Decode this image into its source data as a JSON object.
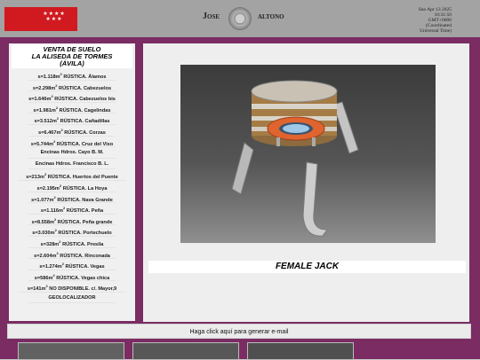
{
  "header": {
    "name_first": "Jose",
    "name_last": "altono",
    "datetime_lines": [
      "Sun Apr 13 2025",
      "10:31:50",
      "GMT+0000",
      "(Coordinated",
      "Universal Time)"
    ]
  },
  "sidebar": {
    "title_lines": [
      "VENTA DE SUELO",
      "LA ALISEDA DE TORMES",
      "(ÁVILA)"
    ],
    "items": [
      {
        "area": "s=1.118m",
        "desc": " RÚSTICA. Álamos",
        "sup": "2"
      },
      {
        "area": "s=2.298m",
        "desc": " RÚSTICA. Cabezuelos",
        "sup": "2"
      },
      {
        "area": "s=1.646m",
        "desc": " RÚSTICA. Cabezuelos bis",
        "sup": "2"
      },
      {
        "area": "s=1.981m",
        "desc": " RÚSTICA. Cagelindas",
        "sup": "2"
      },
      {
        "area": "s=3.512m",
        "desc": " RÚSTICA. Cañadillas",
        "sup": "2"
      },
      {
        "area": "s=6.467m",
        "desc": " RÚSTICA. Corzas",
        "sup": "2"
      },
      {
        "area": "s=5.744m",
        "desc": " RÚSTICA. Cruz del Viso",
        "sup": "2"
      },
      {
        "area": "",
        "desc": "Encinas Hdros. Cayo B. M.",
        "sup": ""
      },
      {
        "area": "",
        "desc": "Encinas Hdros. Francisco B. L.",
        "sup": ""
      },
      {
        "area": "s=213m",
        "desc": " RÚSTICA. Huertos del Puente",
        "sup": "2"
      },
      {
        "area": "s=2.195m",
        "desc": " RÚSTICA. La Hoya",
        "sup": "2"
      },
      {
        "area": "s=1.077m",
        "desc": " RÚSTICA. Nava Grande",
        "sup": "2"
      },
      {
        "area": "s=1.116m",
        "desc": " RÚSTICA. Peña",
        "sup": "2"
      },
      {
        "area": "s=8.558m",
        "desc": " RÚSTICA. Peña grande",
        "sup": "2"
      },
      {
        "area": "s=3.030m",
        "desc": " RÚSTICA. Portechuelo",
        "sup": "2"
      },
      {
        "area": "s=328m",
        "desc": " RÚSTICA. Presila",
        "sup": "2"
      },
      {
        "area": "s=2.604m",
        "desc": " RÚSTICA. Rinconada",
        "sup": "2"
      },
      {
        "area": "s=1.274m",
        "desc": " RÚSTICA. Vegas",
        "sup": "2"
      },
      {
        "area": "s=586m",
        "desc": " RÚSTICA. Vegas chica",
        "sup": "2"
      },
      {
        "area": "s=141m",
        "desc": " NO DISPONIBLE. c/. Mayor,9",
        "sup": "2"
      },
      {
        "area": "",
        "desc": "GEOLOCALIZADOR",
        "sup": ""
      }
    ]
  },
  "main": {
    "product_title": "FEMALE JACK"
  },
  "footer": {
    "email_link": "Haga click aquí para generar e-mail"
  },
  "flag": {
    "color": "#d01a1f",
    "stars": "★★★★\n★★★"
  },
  "colors": {
    "frame": "#7a2c63",
    "topbar": "#a3a3a3"
  }
}
